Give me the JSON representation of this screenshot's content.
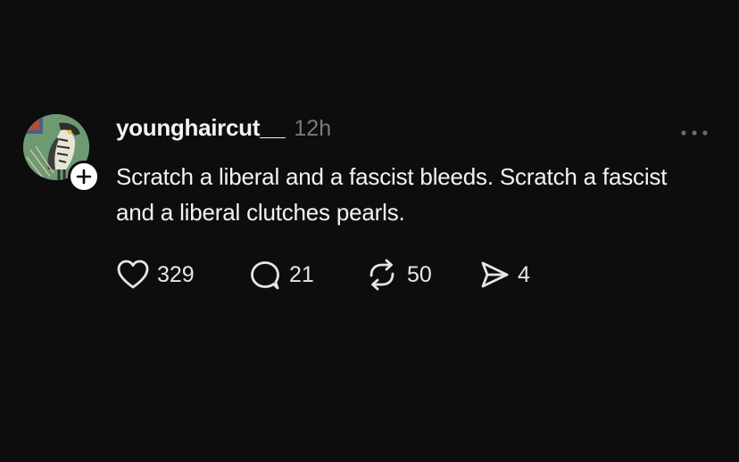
{
  "post": {
    "author": {
      "username": "younghaircut__",
      "avatar_icon": "hawk-illustration-avatar"
    },
    "timestamp": "12h",
    "text": "Scratch a liberal and a fascist bleeds. Scratch a fascist and a liberal clutches pearls.",
    "actions": {
      "likes": "329",
      "replies": "21",
      "reposts": "50",
      "shares": "4"
    }
  },
  "colors": {
    "background": "#0d0d0d",
    "text_primary": "#f3f3f3",
    "text_secondary": "#7a7a7a",
    "avatar_bg": "#6e9a72"
  }
}
